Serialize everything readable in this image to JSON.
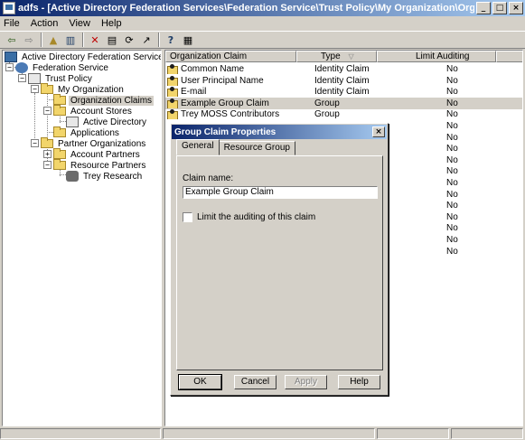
{
  "window": {
    "title": "adfs - [Active Directory Federation Services\\Federation Service\\Trust Policy\\My Organization\\Organization Claims]",
    "minimize": "_",
    "maximize": "□",
    "close": "×"
  },
  "menu": [
    {
      "label": "File"
    },
    {
      "label": "Action"
    },
    {
      "label": "View"
    },
    {
      "label": "Help"
    }
  ],
  "toolbar": {
    "back": "⇦",
    "forward": "⇨",
    "up": "▲",
    "show_tree": "▥",
    "delete": "✕",
    "properties": "▤",
    "refresh": "⟳",
    "export": "↗",
    "help": "?",
    "view": "▦"
  },
  "tree": [
    {
      "label": "Active Directory Federation Services",
      "icon": "root-icon"
    },
    {
      "label": "Federation Service",
      "icon": "federation-icon"
    },
    {
      "label": "Trust Policy",
      "icon": "policy-icon"
    },
    {
      "label": "My Organization",
      "icon": "folder-icon"
    },
    {
      "label": "Organization Claims",
      "icon": "folder-icon"
    },
    {
      "label": "Account Stores",
      "icon": "folder-icon"
    },
    {
      "label": "Active Directory",
      "icon": "store-icon"
    },
    {
      "label": "Applications",
      "icon": "folder-icon"
    },
    {
      "label": "Partner Organizations",
      "icon": "folder-icon"
    },
    {
      "label": "Account Partners",
      "icon": "folder-icon"
    },
    {
      "label": "Resource Partners",
      "icon": "folder-icon"
    },
    {
      "label": "Trey Research",
      "icon": "partner-icon"
    }
  ],
  "list": {
    "columns": [
      "Organization Claim",
      "Type",
      "Limit Auditing"
    ],
    "sort_glyph": "▽",
    "rows": [
      {
        "name": "Common Name",
        "type": "Identity Claim",
        "audit": "No"
      },
      {
        "name": "User Principal Name",
        "type": "Identity Claim",
        "audit": "No"
      },
      {
        "name": "E-mail",
        "type": "Identity Claim",
        "audit": "No"
      },
      {
        "name": "Example Group Claim",
        "type": "Group",
        "audit": "No"
      },
      {
        "name": "Trey MOSS Contributors",
        "type": "Group",
        "audit": "No"
      },
      {
        "name": "",
        "type": "",
        "audit": "No"
      },
      {
        "name": "",
        "type": "",
        "audit": "No"
      },
      {
        "name": "",
        "type": "",
        "audit": "No"
      },
      {
        "name": "",
        "type": "",
        "audit": "No"
      },
      {
        "name": "",
        "type": "",
        "audit": "No"
      },
      {
        "name": "",
        "type": "",
        "audit": "No"
      },
      {
        "name": "",
        "type": "",
        "audit": "No"
      },
      {
        "name": "",
        "type": "",
        "audit": "No"
      },
      {
        "name": "",
        "type": "",
        "audit": "No"
      },
      {
        "name": "",
        "type": "",
        "audit": "No"
      },
      {
        "name": "",
        "type": "",
        "audit": "No"
      },
      {
        "name": "",
        "type": "",
        "audit": "No"
      }
    ]
  },
  "dialog": {
    "title": "Group Claim Properties",
    "close": "×",
    "tabs": [
      "General",
      "Resource Group"
    ],
    "claim_name_label": "Claim name:",
    "claim_name_value": "Example Group Claim",
    "limit_auditing_label": "Limit the auditing of this claim",
    "buttons": {
      "ok": "OK",
      "cancel": "Cancel",
      "apply": "Apply",
      "help": "Help"
    }
  }
}
